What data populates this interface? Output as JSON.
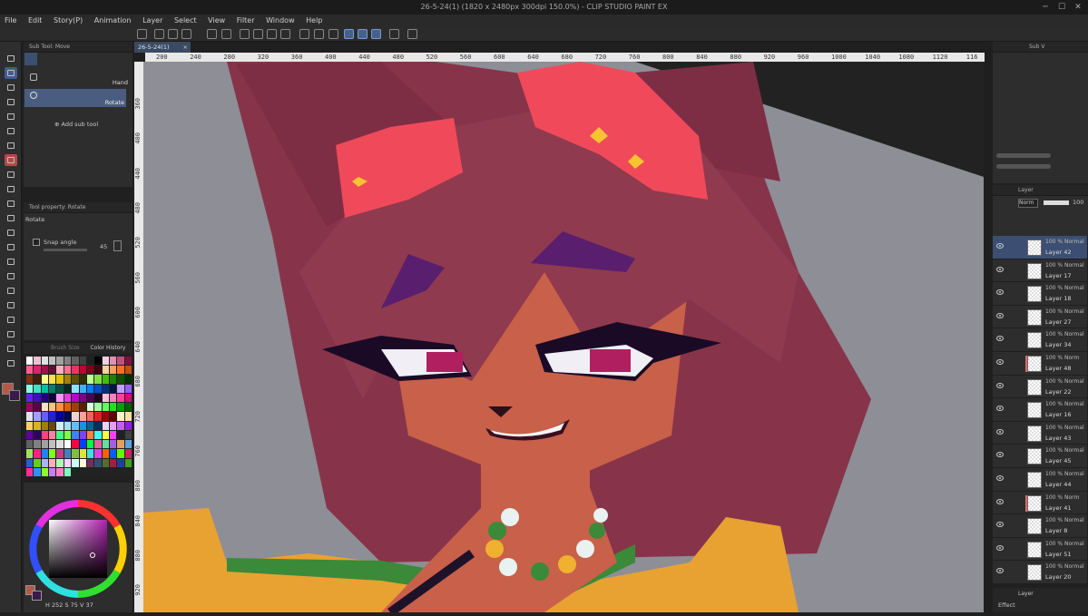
{
  "window": {
    "title": "26-5-24(1) (1820 x 2480px 300dpi 150.0%) - CLIP STUDIO PAINT EX"
  },
  "menu": [
    "File",
    "Edit",
    "Story(P)",
    "Animation",
    "Layer",
    "Select",
    "View",
    "Filter",
    "Window",
    "Help"
  ],
  "subtool_panel": {
    "header": "Sub Tool: Move",
    "items": [
      "Hand",
      "Rotate"
    ],
    "selected": "Rotate",
    "add_label": "Add sub tool"
  },
  "tool_property": {
    "header": "Tool property: Rotate",
    "title": "Rotate",
    "snap_label": "Snap angle",
    "snap_value": "45"
  },
  "color_panel": {
    "tabs": [
      "Brush Size",
      "Color History"
    ],
    "hsv": [
      "252",
      "75",
      "37"
    ],
    "main_color": "#b25a4a",
    "sub_color": "#3a1a4a"
  },
  "document": {
    "tab": "26-5-24(1)"
  },
  "ruler_top": [
    "200",
    "240",
    "280",
    "320",
    "360",
    "400",
    "440",
    "480",
    "520",
    "560",
    "600",
    "640",
    "680",
    "720",
    "760",
    "800",
    "840",
    "880",
    "920",
    "960",
    "1000",
    "1040",
    "1080",
    "1120",
    "116"
  ],
  "ruler_left": [
    "360",
    "400",
    "440",
    "480",
    "520",
    "560",
    "600",
    "640",
    "680",
    "720",
    "760",
    "800",
    "840",
    "880",
    "920"
  ],
  "right_top": {
    "header": "Sub V"
  },
  "layer_panel": {
    "header": "Layer",
    "blend": "Norm",
    "opacity": "100",
    "layers": [
      {
        "mode": "100 % Normal",
        "name": "Layer 42",
        "selected": true,
        "mark": false
      },
      {
        "mode": "100 % Normal",
        "name": "Layer 17",
        "selected": false,
        "mark": false
      },
      {
        "mode": "100 % Normal",
        "name": "Layer 18",
        "selected": false,
        "mark": false
      },
      {
        "mode": "100 % Normal",
        "name": "Layer 27",
        "selected": false,
        "mark": false
      },
      {
        "mode": "100 % Normal",
        "name": "Layer 34",
        "selected": false,
        "mark": false
      },
      {
        "mode": "100 % Norm",
        "name": "Layer 48",
        "selected": false,
        "mark": true
      },
      {
        "mode": "100 % Normal",
        "name": "Layer 22",
        "selected": false,
        "mark": false
      },
      {
        "mode": "100 % Normal",
        "name": "Layer 16",
        "selected": false,
        "mark": false
      },
      {
        "mode": "100 % Normal",
        "name": "Layer 43",
        "selected": false,
        "mark": false
      },
      {
        "mode": "100 % Normal",
        "name": "Layer 45",
        "selected": false,
        "mark": false
      },
      {
        "mode": "100 % Normal",
        "name": "Layer 44",
        "selected": false,
        "mark": false
      },
      {
        "mode": "100 % Norm",
        "name": "Layer 41",
        "selected": false,
        "mark": true
      },
      {
        "mode": "100 % Normal",
        "name": "Layer 8",
        "selected": false,
        "mark": false
      },
      {
        "mode": "100 % Normal",
        "name": "Layer 51",
        "selected": false,
        "mark": false
      },
      {
        "mode": "100 % Normal",
        "name": "Layer 20",
        "selected": false,
        "mark": false
      }
    ],
    "bottom_tabs": [
      "Layer"
    ],
    "effect_label": "Effect"
  },
  "palette_colors": [
    "#ffffff",
    "#f0c0d0",
    "#e0e0e0",
    "#c0c0c0",
    "#a0a0a0",
    "#808080",
    "#606060",
    "#404040",
    "#202020",
    "#000000",
    "#f4d0e0",
    "#e090b0",
    "#c05080",
    "#801040",
    "#ff6090",
    "#e02070",
    "#a01050",
    "#601030",
    "#ffb0c0",
    "#ff7090",
    "#ff3060",
    "#c00030",
    "#800020",
    "#400010",
    "#ffd0a0",
    "#ffa060",
    "#ff7020",
    "#c05010",
    "#803010",
    "#402008",
    "#ffff90",
    "#ffe040",
    "#e0c000",
    "#a08000",
    "#605000",
    "#303000",
    "#c0ff90",
    "#80e040",
    "#40c000",
    "#208000",
    "#105000",
    "#003000",
    "#90ffe0",
    "#40e0c0",
    "#00c0a0",
    "#008070",
    "#005040",
    "#002820",
    "#90e0ff",
    "#40b0ff",
    "#0080ff",
    "#0050c0",
    "#003080",
    "#001840",
    "#c0a0ff",
    "#9060ff",
    "#6020ff",
    "#4010c0",
    "#200080",
    "#100040",
    "#ff90ff",
    "#e040e0",
    "#c000c0",
    "#800080",
    "#500050",
    "#200020",
    "#ffc0e0",
    "#ff80c0",
    "#ff40a0",
    "#e00080",
    "#a00060",
    "#600040",
    "#ffe0c0",
    "#ffc080",
    "#ff9040",
    "#e06000",
    "#a04000",
    "#602000",
    "#e0ffe0",
    "#a0ffa0",
    "#60ff60",
    "#20e020",
    "#00a000",
    "#006000",
    "#e0e0ff",
    "#a0a0ff",
    "#6060ff",
    "#2020e0",
    "#0000a0",
    "#000060",
    "#ffd0d0",
    "#ffa0a0",
    "#ff6060",
    "#e02020",
    "#a00000",
    "#600000",
    "#fff0d0",
    "#ffe0a0",
    "#ffd060",
    "#e0b020",
    "#a08000",
    "#605000",
    "#d0f0ff",
    "#a0e0ff",
    "#60c0ff",
    "#2090e0",
    "#0060a0",
    "#003060",
    "#f0d0ff",
    "#e0a0ff",
    "#c060ff",
    "#9020e0",
    "#6000a0",
    "#300060",
    "#ff4080",
    "#ff80a0",
    "#40ff80",
    "#80ff40",
    "#4080ff",
    "#8040ff",
    "#ff8040",
    "#40ffff",
    "#ffff40",
    "#ff40ff",
    "#202020",
    "#404040",
    "#606060",
    "#808080",
    "#a0a0a0",
    "#c0c0c0",
    "#e0e0e0",
    "#ffffff",
    "#ff0040",
    "#0040ff",
    "#00ff40",
    "#e060a0",
    "#60e0a0",
    "#a060e0",
    "#e0a060",
    "#60a0e0",
    "#a0e060",
    "#ff2080",
    "#2080ff",
    "#80ff20",
    "#c04080",
    "#4080c0",
    "#80c040",
    "#e0e040",
    "#40e0e0",
    "#e040e0",
    "#ff6000",
    "#0060ff",
    "#60ff00",
    "#d02060",
    "#2060d0",
    "#60d020",
    "#b0b0ff",
    "#ffb0b0",
    "#b0ffb0",
    "#ffd0ff",
    "#d0ffff",
    "#ffffd0",
    "#703050",
    "#305070",
    "#507030",
    "#a02040",
    "#2040a0",
    "#40a020",
    "#ff3090",
    "#3090ff",
    "#90ff30",
    "#c080ff",
    "#ff80c0",
    "#80ffc0"
  ]
}
